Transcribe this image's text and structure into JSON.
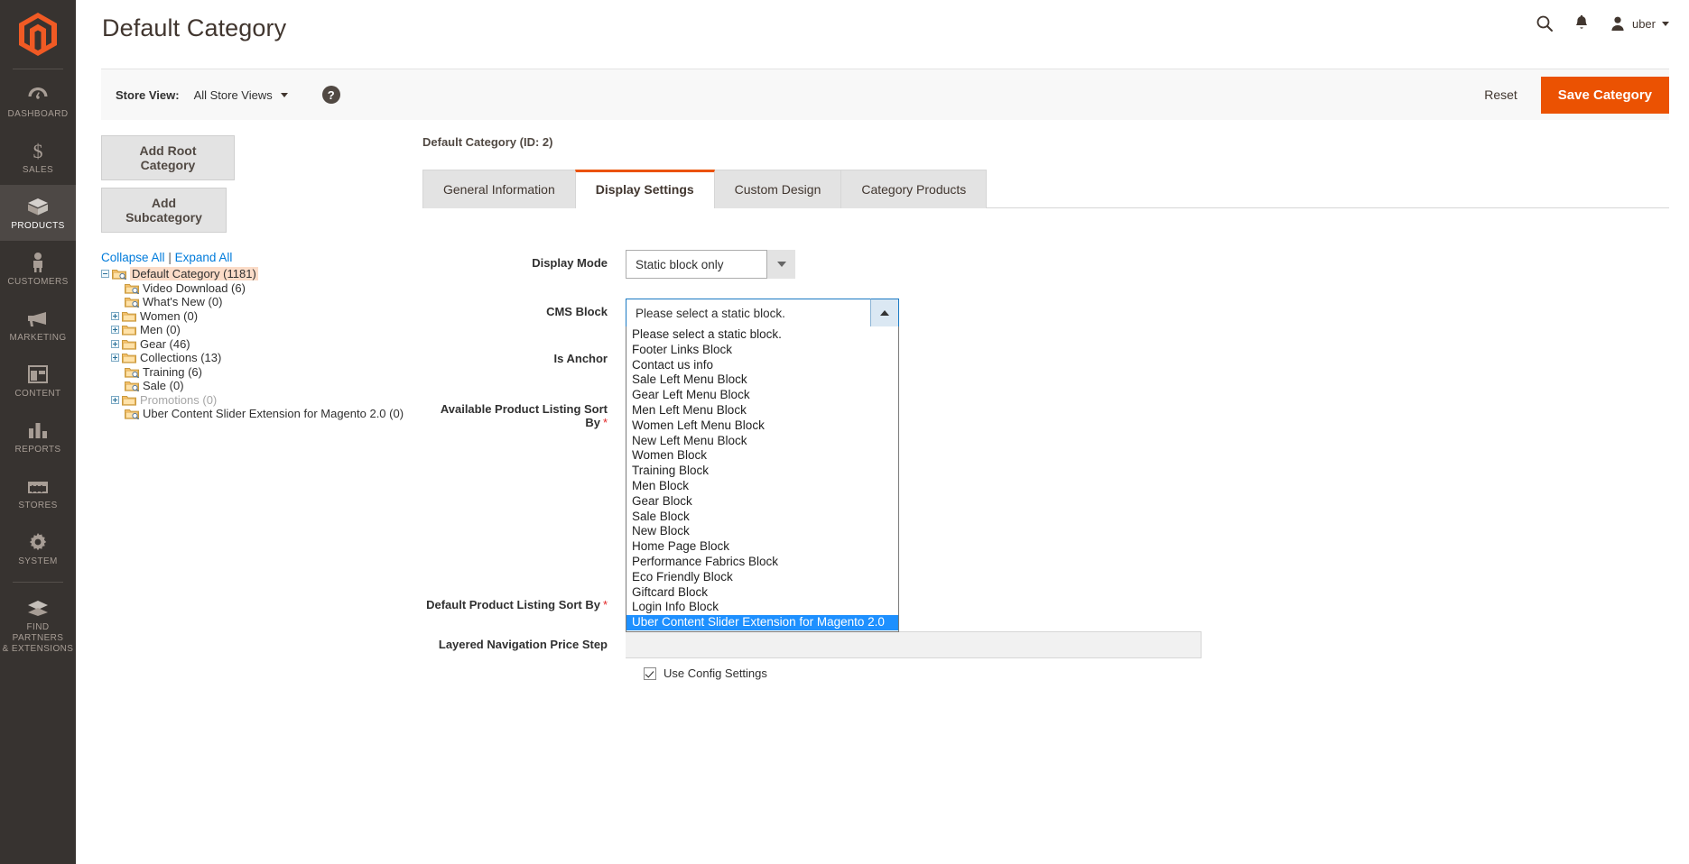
{
  "admin_nav": {
    "logo": "magento-logo",
    "items": [
      {
        "label": "DASHBOARD",
        "icon": "dashboard-icon",
        "active": false
      },
      {
        "label": "SALES",
        "icon": "dollar-icon",
        "active": false
      },
      {
        "label": "PRODUCTS",
        "icon": "products-box-icon",
        "active": true
      },
      {
        "label": "CUSTOMERS",
        "icon": "person-icon",
        "active": false
      },
      {
        "label": "MARKETING",
        "icon": "megaphone-icon",
        "active": false
      },
      {
        "label": "CONTENT",
        "icon": "layout-icon",
        "active": false
      },
      {
        "label": "REPORTS",
        "icon": "bar-chart-icon",
        "active": false
      },
      {
        "label": "STORES",
        "icon": "storefront-icon",
        "active": false
      },
      {
        "label": "SYSTEM",
        "icon": "gear-icon",
        "active": false
      },
      {
        "label": "FIND PARTNERS\n& EXTENSIONS",
        "label_line1": "FIND PARTNERS",
        "label_line2": "& EXTENSIONS",
        "icon": "extensions-icon",
        "active": false
      }
    ]
  },
  "header": {
    "title": "Default Category",
    "search_icon": "search-icon",
    "notifications_icon": "bell-icon",
    "user_icon": "user-avatar-icon",
    "user_name": "uber"
  },
  "page_actions": {
    "store_view_label": "Store View:",
    "store_view_value": "All Store Views",
    "help_icon": "question-mark-icon",
    "reset_label": "Reset",
    "save_label": "Save Category"
  },
  "left_panel": {
    "add_root_label": "Add Root Category",
    "add_subcategory_label": "Add Subcategory",
    "collapse_all_label": "Collapse All",
    "separator": "|",
    "expand_all_label": "Expand All",
    "tree": [
      {
        "label": "Default Category (1181)",
        "depth": 0,
        "expander": "minus",
        "selected": true,
        "dim": false
      },
      {
        "label": "Video Download (6)",
        "depth": 1,
        "expander": "none",
        "selected": false,
        "dim": false
      },
      {
        "label": "What's New (0)",
        "depth": 1,
        "expander": "none",
        "selected": false,
        "dim": false
      },
      {
        "label": "Women (0)",
        "depth": 1,
        "expander": "plus",
        "selected": false,
        "dim": false
      },
      {
        "label": "Men (0)",
        "depth": 1,
        "expander": "plus",
        "selected": false,
        "dim": false
      },
      {
        "label": "Gear (46)",
        "depth": 1,
        "expander": "plus",
        "selected": false,
        "dim": false
      },
      {
        "label": "Collections (13)",
        "depth": 1,
        "expander": "plus",
        "selected": false,
        "dim": false
      },
      {
        "label": "Training (6)",
        "depth": 1,
        "expander": "none",
        "selected": false,
        "dim": false
      },
      {
        "label": "Sale (0)",
        "depth": 1,
        "expander": "none",
        "selected": false,
        "dim": false
      },
      {
        "label": "Promotions (0)",
        "depth": 1,
        "expander": "plus",
        "selected": false,
        "dim": true
      },
      {
        "label": "Uber Content Slider Extension for Magento 2.0 (0)",
        "depth": 1,
        "expander": "none",
        "selected": false,
        "dim": false
      }
    ]
  },
  "main": {
    "category_id_text": "Default Category (ID: 2)",
    "tabs": [
      {
        "label": "General Information",
        "active": false
      },
      {
        "label": "Display Settings",
        "active": true
      },
      {
        "label": "Custom Design",
        "active": false
      },
      {
        "label": "Category Products",
        "active": false
      }
    ],
    "fields": {
      "display_mode": {
        "label": "Display Mode",
        "value": "Static block only"
      },
      "cms_block": {
        "label": "CMS Block",
        "value": "Please select a static block.",
        "expanded": true,
        "options": [
          "Please select a static block.",
          "Footer Links Block",
          "Contact us info",
          "Sale Left Menu Block",
          "Gear Left Menu Block",
          "Men Left Menu Block",
          "Women Left Menu Block",
          "New Left Menu Block",
          "Women Block",
          "Training Block",
          "Men Block",
          "Gear Block",
          "Sale Block",
          "New Block",
          "Home Page Block",
          "Performance Fabrics Block",
          "Eco Friendly Block",
          "Giftcard Block",
          "Login Info Block",
          "Uber Content Slider Extension for Magento 2.0"
        ],
        "selected_option": "Uber Content Slider Extension for Magento 2.0"
      },
      "is_anchor": {
        "label": "Is Anchor"
      },
      "available_sort_by": {
        "label": "Available Product Listing Sort By",
        "required": "*"
      },
      "default_sort_by": {
        "label": "Default Product Listing Sort By",
        "required": "*"
      },
      "price_step": {
        "label": "Layered Navigation Price Step",
        "value": ""
      },
      "use_config": {
        "label": "Use Config Settings",
        "checked": true
      }
    }
  },
  "colors": {
    "brand_orange": "#eb5202",
    "nav_dark": "#373330",
    "highlight_blue": "#1e90ff",
    "link_blue": "#007bdb"
  }
}
